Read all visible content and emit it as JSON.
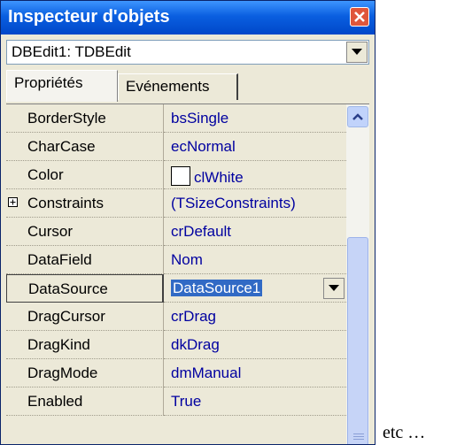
{
  "window": {
    "title": "Inspecteur d'objets",
    "close_icon": "close-icon"
  },
  "object_selector": {
    "value": "DBEdit1: TDBEdit"
  },
  "tabs": [
    {
      "label": "Propriétés",
      "active": true
    },
    {
      "label": "Evénements",
      "active": false
    }
  ],
  "properties": [
    {
      "name": "BorderStyle",
      "value": "bsSingle"
    },
    {
      "name": "CharCase",
      "value": "ecNormal"
    },
    {
      "name": "Color",
      "value": "clWhite",
      "swatch": "#ffffff"
    },
    {
      "name": "Constraints",
      "value": "(TSizeConstraints)",
      "expandable": true
    },
    {
      "name": "Cursor",
      "value": "crDefault"
    },
    {
      "name": "DataField",
      "value": "Nom"
    },
    {
      "name": "DataSource",
      "value": "DataSource1",
      "selected": true
    },
    {
      "name": "DragCursor",
      "value": "crDrag"
    },
    {
      "name": "DragKind",
      "value": "dkDrag"
    },
    {
      "name": "DragMode",
      "value": "dmManual"
    },
    {
      "name": "Enabled",
      "value": "True"
    }
  ],
  "caption": "etc …",
  "colors": {
    "titlebar": "#0a5fe0",
    "value_text": "#0000a0",
    "selection": "#316ac5"
  }
}
